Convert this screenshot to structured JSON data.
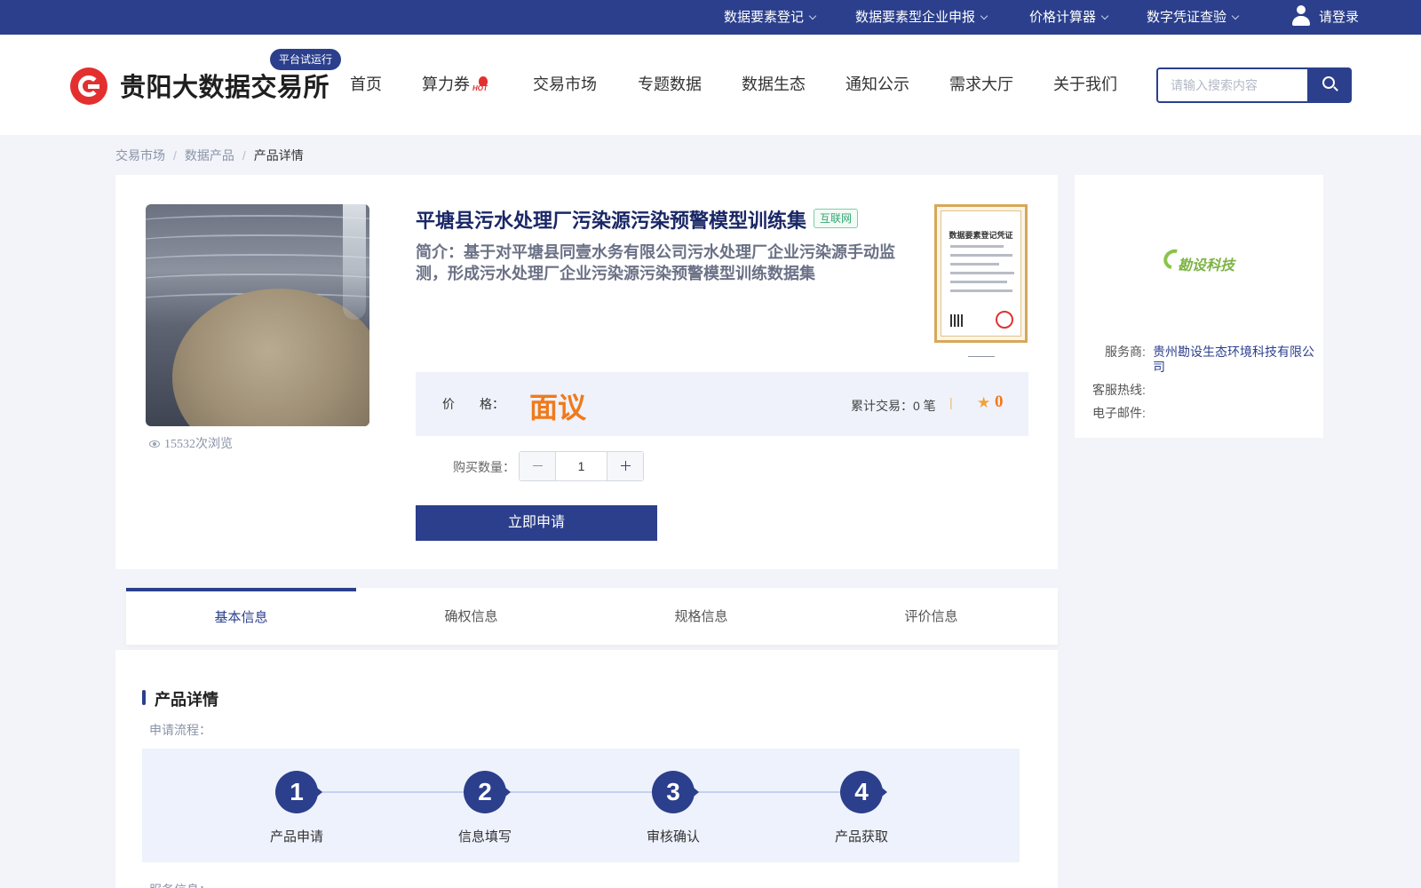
{
  "topbar": {
    "items": [
      {
        "label": "数据要素登记"
      },
      {
        "label": "数据要素型企业申报"
      },
      {
        "label": "价格计算器"
      },
      {
        "label": "数字凭证查验"
      }
    ],
    "login_label": "请登录"
  },
  "header": {
    "logo_text": "贵阳大数据交易所",
    "trial_badge": "平台试运行",
    "nav": [
      {
        "label": "首页"
      },
      {
        "label": "算力券",
        "hot": "HOT"
      },
      {
        "label": "交易市场"
      },
      {
        "label": "专题数据"
      },
      {
        "label": "数据生态"
      },
      {
        "label": "通知公示"
      },
      {
        "label": "需求大厅"
      },
      {
        "label": "关于我们"
      }
    ],
    "search": {
      "placeholder": "请输入搜索内容",
      "value": ""
    }
  },
  "breadcrumb": {
    "items": [
      "交易市场",
      "数据产品",
      "产品详情"
    ],
    "separator": "/"
  },
  "product": {
    "title": "平塘县污水处理厂污染源污染预警模型训练集",
    "tag": "互联网",
    "intro": "简介：基于对平塘县同壹水务有限公司污水处理厂企业污染源手动监测，形成污水处理厂企业污染源污染预警模型训练数据集",
    "views": "15532次浏览",
    "cert_title": "数据要素登记凭证",
    "price_label": "价　　格：",
    "price_value": "面议",
    "trade_count": "累计交易：0 笔",
    "trade_sep": "|",
    "rating": "0",
    "quantity_label": "购买数量：",
    "quantity_value": "1",
    "apply_label": "立即申请"
  },
  "provider": {
    "logo_text": "勘设科技",
    "service_key": "服务商:",
    "service_value": "贵州勘设生态环境科技有限公司",
    "hotline_key": "客服热线:",
    "hotline_value": "",
    "email_key": "电子邮件:",
    "email_value": ""
  },
  "tabs": [
    {
      "label": "基本信息",
      "active": true
    },
    {
      "label": "确权信息",
      "active": false
    },
    {
      "label": "规格信息",
      "active": false
    },
    {
      "label": "评价信息",
      "active": false
    }
  ],
  "detail": {
    "section_title": "产品详情",
    "flow_label": "申请流程：",
    "steps": [
      {
        "num": "1",
        "label": "产品申请"
      },
      {
        "num": "2",
        "label": "信息填写"
      },
      {
        "num": "3",
        "label": "审核确认"
      },
      {
        "num": "4",
        "label": "产品获取"
      }
    ],
    "service_label": "服务信息："
  },
  "colors": {
    "brand": "#2b3f8c",
    "price": "#f07a1c",
    "logo_red": "#e42f2f",
    "tag_green": "#35a672"
  }
}
